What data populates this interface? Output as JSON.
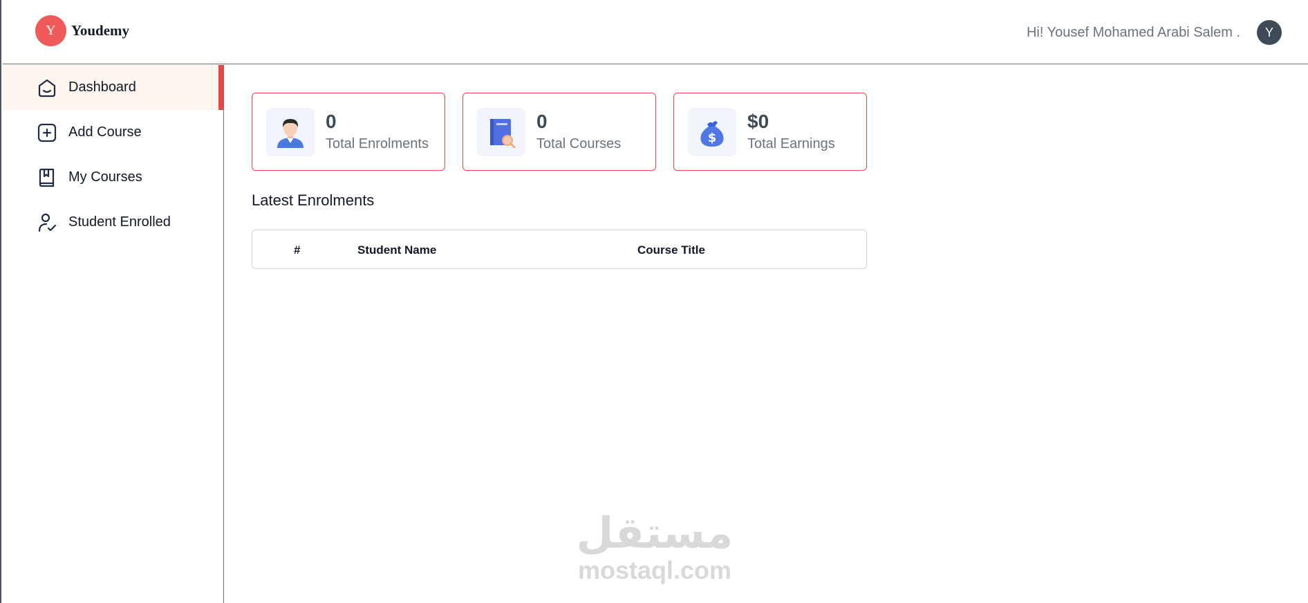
{
  "header": {
    "logo_letter": "Y",
    "brand": "Youdemy",
    "greeting": "Hi! Yousef Mohamed Arabi Salem .",
    "avatar_letter": "Y"
  },
  "sidebar": {
    "items": [
      {
        "label": "Dashboard",
        "icon": "home-icon",
        "active": true
      },
      {
        "label": "Add Course",
        "icon": "add-square-icon",
        "active": false
      },
      {
        "label": "My Courses",
        "icon": "bookmark-book-icon",
        "active": false
      },
      {
        "label": "Student Enrolled",
        "icon": "user-check-icon",
        "active": false
      }
    ]
  },
  "cards": [
    {
      "value": "0",
      "label": "Total Enrolments",
      "icon": "student-icon"
    },
    {
      "value": "0",
      "label": "Total Courses",
      "icon": "book-search-icon"
    },
    {
      "value": "$0",
      "label": "Total Earnings",
      "icon": "money-bag-icon"
    }
  ],
  "latest": {
    "title": "Latest Enrolments",
    "columns": [
      "#",
      "Student Name",
      "Course Title"
    ]
  },
  "watermark": {
    "arabic": "مستقل",
    "latin": "mostaql.com"
  },
  "colors": {
    "accent": "#ef4444",
    "logo_bg": "#f05a5a",
    "avatar_bg": "#3f4a59",
    "active_bg": "#fff6ef"
  }
}
